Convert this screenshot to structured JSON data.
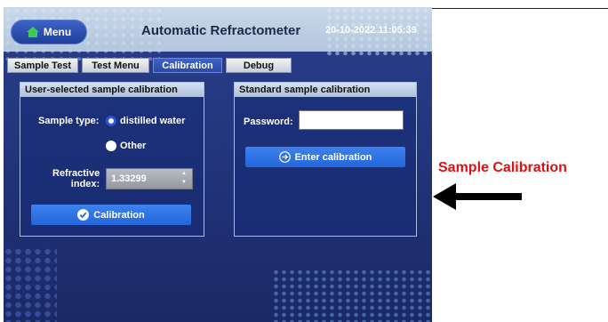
{
  "header": {
    "menu_label": "Menu",
    "title": "Automatic Refractometer",
    "datetime": "20-10-2022 11:05:39"
  },
  "tabs": [
    {
      "label": "Sample Test",
      "active": false
    },
    {
      "label": "Test Menu",
      "active": false
    },
    {
      "label": "Calibration",
      "active": true
    },
    {
      "label": "Debug",
      "active": false
    }
  ],
  "user_calibration": {
    "title": "User-selected sample calibration",
    "sample_type_label": "Sample type:",
    "options": [
      {
        "label": "distilled water",
        "selected": true
      },
      {
        "label": "Other",
        "selected": false
      }
    ],
    "refractive_index_label_1": "Refractive",
    "refractive_index_label_2": "index:",
    "refractive_index_value": "1.33299",
    "button_label": "Calibration"
  },
  "standard_calibration": {
    "title": "Standard sample calibration",
    "password_label": "Password:",
    "password_value": "",
    "button_label": "Enter calibration"
  },
  "annotation": {
    "text": "Sample Calibration"
  },
  "colors": {
    "screen_bg": "#24377f",
    "button_blue": "#2e74e4",
    "annotation_red": "#dd1111"
  }
}
